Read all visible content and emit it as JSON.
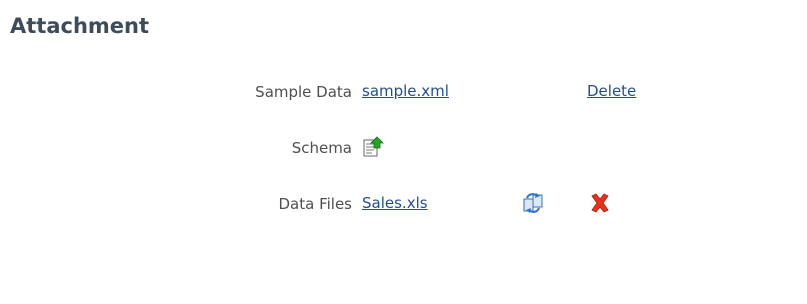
{
  "section": {
    "title": "Attachment"
  },
  "sample_data": {
    "label": "Sample Data",
    "file": "sample.xml",
    "delete_label": "Delete"
  },
  "schema": {
    "label": "Schema",
    "upload_icon": "upload-document-icon"
  },
  "data_files": {
    "label": "Data Files",
    "file": "Sales.xls",
    "refresh_icon": "refresh-icon",
    "remove_icon": "delete-x-icon"
  },
  "colors": {
    "title": "#3d4b5a",
    "label": "#4f4f4f",
    "link": "#1f4f8f",
    "delete_x": "#e8321c",
    "upload_arrow": "#22a822",
    "refresh": "#2b74c7"
  }
}
